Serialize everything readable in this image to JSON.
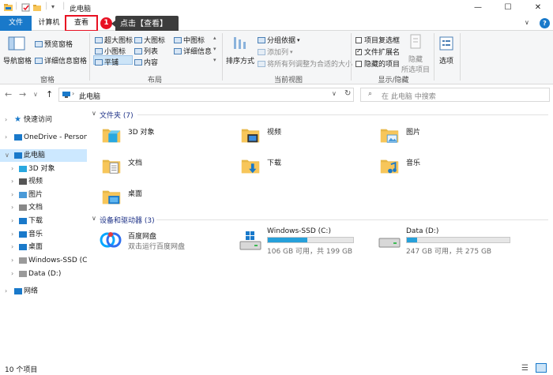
{
  "window": {
    "title": "此电脑",
    "title_icons": [
      "explorer-icon",
      "properties-icon",
      "new-folder-icon",
      "qat-dropdown-icon"
    ]
  },
  "tabs": {
    "file": "文件",
    "computer": "计算机",
    "view": "查看"
  },
  "callout": {
    "number": "1",
    "text": "点击【查看】"
  },
  "ribbon": {
    "panes": {
      "nav_pane": "导航窗格",
      "preview_pane": "预览窗格",
      "details_pane": "详细信息窗格",
      "group_label": "窗格"
    },
    "layout": {
      "xl_icons": "超大图标",
      "l_icons": "大图标",
      "m_icons": "中图标",
      "s_icons": "小图标",
      "list": "列表",
      "details": "详细信息",
      "tiles": "平铺",
      "content": "内容",
      "group_label": "布局",
      "selected": "平铺"
    },
    "current_view": {
      "sort_by": "排序方式",
      "group_by": "分组依据",
      "add_column": "添加列",
      "fit_columns": "将所有列调整为合适的大小",
      "group_label": "当前视图"
    },
    "show_hide": {
      "item_checkboxes": "项目复选框",
      "file_extensions": "文件扩展名",
      "hidden_items": "隐藏的项目",
      "hide_selected_line1": "隐藏",
      "hide_selected_line2": "所选项目",
      "options": "选项",
      "group_label": "显示/隐藏",
      "item_checkboxes_checked": false,
      "file_extensions_checked": true,
      "hidden_items_checked": false
    }
  },
  "address": {
    "path": "此电脑",
    "search_placeholder": "在 此电脑 中搜索"
  },
  "nav": [
    {
      "label": "快速访问",
      "icon": "star-icon"
    },
    {
      "label": "OneDrive - Persona",
      "icon": "cloud-icon"
    },
    {
      "label": "此电脑",
      "icon": "computer-icon"
    },
    {
      "label": "3D 对象",
      "icon": "3d-objects-icon"
    },
    {
      "label": "视频",
      "icon": "videos-icon"
    },
    {
      "label": "图片",
      "icon": "pictures-icon"
    },
    {
      "label": "文档",
      "icon": "documents-icon"
    },
    {
      "label": "下载",
      "icon": "downloads-icon"
    },
    {
      "label": "音乐",
      "icon": "music-icon"
    },
    {
      "label": "桌面",
      "icon": "desktop-icon"
    },
    {
      "label": "Windows-SSD (C:)",
      "icon": "drive-icon"
    },
    {
      "label": "Data (D:)",
      "icon": "drive-icon"
    },
    {
      "label": "网络",
      "icon": "network-icon"
    }
  ],
  "folders_section": {
    "title": "文件夹 (7)"
  },
  "folders": [
    {
      "label": "3D 对象",
      "icon": "3d-objects-folder-icon"
    },
    {
      "label": "视频",
      "icon": "videos-folder-icon"
    },
    {
      "label": "图片",
      "icon": "pictures-folder-icon"
    },
    {
      "label": "文档",
      "icon": "documents-folder-icon"
    },
    {
      "label": "下载",
      "icon": "downloads-folder-icon"
    },
    {
      "label": "音乐",
      "icon": "music-folder-icon"
    },
    {
      "label": "桌面",
      "icon": "desktop-folder-icon"
    }
  ],
  "devices_section": {
    "title": "设备和驱动器 (3)"
  },
  "devices": [
    {
      "name": "百度网盘",
      "sub": "双击运行百度网盘",
      "icon": "baidu-netdisk-icon"
    },
    {
      "name": "Windows-SSD (C:)",
      "sub": "106 GB 可用，共 199 GB",
      "icon": "windows-drive-icon",
      "used_fraction": 0.467,
      "color": "#26a0da"
    },
    {
      "name": "Data (D:)",
      "sub": "247 GB 可用，共 275 GB",
      "icon": "drive-icon",
      "used_fraction": 0.102,
      "color": "#26a0da"
    }
  ],
  "status": {
    "text": "10 个项目"
  },
  "colors": {
    "accent": "#1979ca",
    "highlight": "#e81123",
    "selection": "#cce8ff",
    "folder": "#f7c65a"
  }
}
